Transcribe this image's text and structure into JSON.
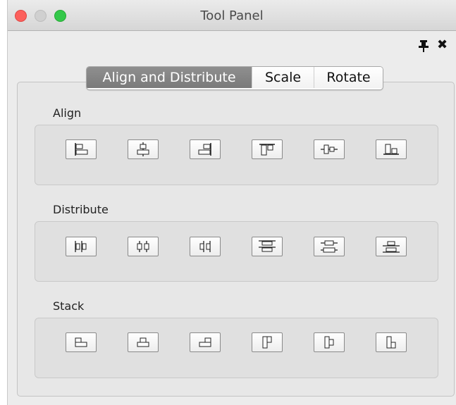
{
  "window": {
    "title": "Tool Panel"
  },
  "tabs": [
    {
      "label": "Align and Distribute",
      "active": true
    },
    {
      "label": "Scale",
      "active": false
    },
    {
      "label": "Rotate",
      "active": false
    }
  ],
  "sections": {
    "align": {
      "label": "Align",
      "tools": [
        "align-left-icon",
        "align-horizontal-center-icon",
        "align-right-icon",
        "align-top-icon",
        "align-vertical-center-icon",
        "align-bottom-icon"
      ]
    },
    "distribute": {
      "label": "Distribute",
      "tools": [
        "distribute-left-icon",
        "distribute-horizontal-center-icon",
        "distribute-right-icon",
        "distribute-top-icon",
        "distribute-vertical-center-icon",
        "distribute-bottom-icon"
      ]
    },
    "stack": {
      "label": "Stack",
      "tools": [
        "stack-left-icon",
        "stack-horizontal-center-icon",
        "stack-right-icon",
        "stack-top-icon",
        "stack-vertical-center-icon",
        "stack-bottom-icon"
      ]
    }
  },
  "colors": {
    "active_tab": "#858585",
    "close": "#fc605c",
    "maximize": "#34c84a"
  }
}
